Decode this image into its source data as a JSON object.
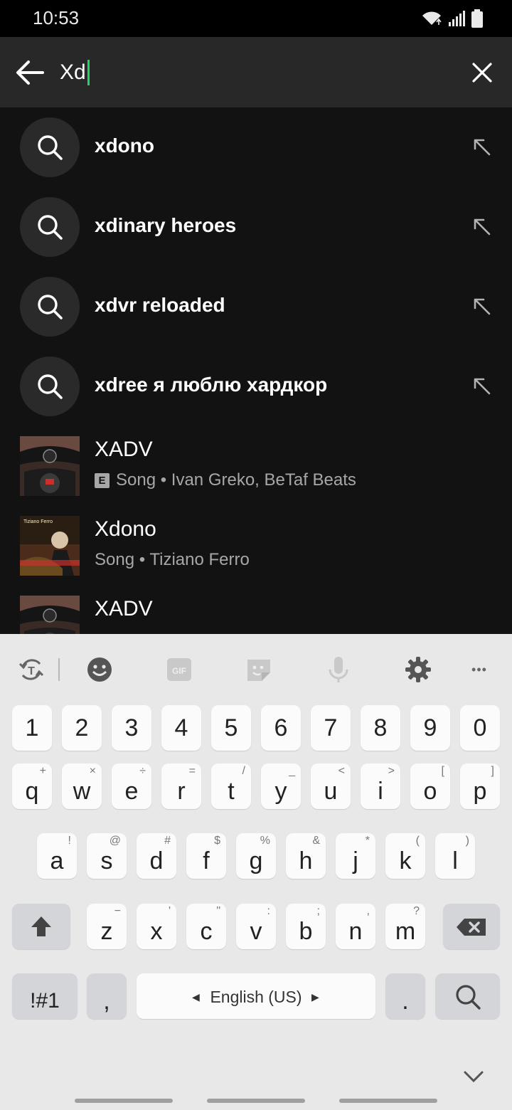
{
  "status_bar": {
    "time": "10:53",
    "icons": [
      "wifi-icon",
      "signal-icon",
      "battery-icon"
    ]
  },
  "search": {
    "query": "Xd",
    "back_icon": "back-arrow-icon",
    "clear_icon": "close-icon",
    "caret_color": "#1ed760"
  },
  "suggestions": [
    {
      "label": "xdono"
    },
    {
      "label": "xdinary heroes"
    },
    {
      "label": "xdvr reloaded"
    },
    {
      "label": "xdree я люблю хардкор"
    }
  ],
  "tracks": [
    {
      "title": "XADV",
      "explicit": "E",
      "subtitle": "Song • Ivan Greko, BeTaf Beats",
      "art": "motorcycle-art"
    },
    {
      "title": "Xdono",
      "explicit": "",
      "subtitle": "Song • Tiziano Ferro",
      "art": "tiziano-ferro-art",
      "art_text": "Tiziano Ferro"
    },
    {
      "title": "XADV",
      "explicit": "",
      "subtitle": "",
      "art": "motorcycle-art"
    }
  ],
  "keyboard": {
    "toolbar": [
      "text-tool-icon",
      "emoji-icon",
      "gif-icon",
      "sticker-icon",
      "mic-icon",
      "settings-icon",
      "more-icon"
    ],
    "gif_label": "GIF",
    "more_label": "•••",
    "numbers": [
      "1",
      "2",
      "3",
      "4",
      "5",
      "6",
      "7",
      "8",
      "9",
      "0"
    ],
    "row1": [
      {
        "k": "q",
        "h": "+"
      },
      {
        "k": "w",
        "h": "×"
      },
      {
        "k": "e",
        "h": "÷"
      },
      {
        "k": "r",
        "h": "="
      },
      {
        "k": "t",
        "h": "/"
      },
      {
        "k": "y",
        "h": "_"
      },
      {
        "k": "u",
        "h": "<"
      },
      {
        "k": "i",
        "h": ">"
      },
      {
        "k": "o",
        "h": "["
      },
      {
        "k": "p",
        "h": "]"
      }
    ],
    "row2": [
      {
        "k": "a",
        "h": "!"
      },
      {
        "k": "s",
        "h": "@"
      },
      {
        "k": "d",
        "h": "#"
      },
      {
        "k": "f",
        "h": "$"
      },
      {
        "k": "g",
        "h": "%"
      },
      {
        "k": "h",
        "h": "&"
      },
      {
        "k": "j",
        "h": "*"
      },
      {
        "k": "k",
        "h": "("
      },
      {
        "k": "l",
        "h": ")"
      }
    ],
    "row3": [
      {
        "k": "z",
        "h": "−"
      },
      {
        "k": "x",
        "h": "'"
      },
      {
        "k": "c",
        "h": "\""
      },
      {
        "k": "v",
        "h": ":"
      },
      {
        "k": "b",
        "h": ";"
      },
      {
        "k": "n",
        "h": ","
      },
      {
        "k": "m",
        "h": "?"
      }
    ],
    "symbols_label": "!#1",
    "comma_label": ",",
    "space_label": "English (US)",
    "period_label": ".",
    "shift_icon": "shift-icon",
    "backspace_icon": "backspace-icon",
    "search_icon": "search-icon",
    "hide_icon": "chevron-down-icon"
  }
}
